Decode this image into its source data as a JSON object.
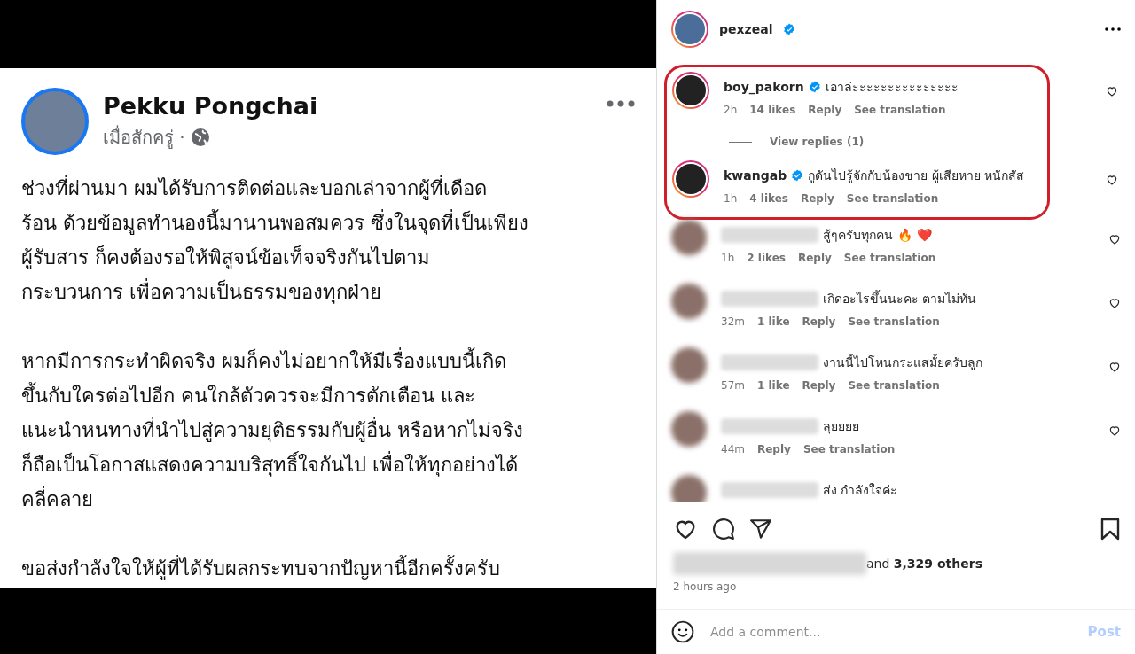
{
  "post_image": {
    "author": "Pekku Pongchai",
    "meta": "เมื่อสักครู่ ·",
    "paragraphs": [
      [
        "ช่วงที่ผ่านมา ผมได้รับการติดต่อและบอกเล่าจากผู้ที่เดือด",
        "ร้อน ด้วยข้อมูลทำนองนี้มานานพอสมควร ซึ่งในจุดที่เป็นเพียง",
        "ผู้รับสาร ก็คงต้องรอให้พิสูจน์ข้อเท็จจริงกันไปตาม",
        "กระบวนการ เพื่อความเป็นธรรมของทุกฝ่าย"
      ],
      [
        "หากมีการกระทำผิดจริง ผมก็คงไม่อยากให้มีเรื่องแบบนี้เกิด",
        "ขึ้นกับใครต่อไปอีก คนใกล้ตัวควรจะมีการตักเตือน และ",
        "แนะนำหนทางที่นำไปสู่ความยุติธรรมกับผู้อื่น หรือหากไม่จริง",
        "ก็ถือเป็นโอกาสแสดงความบริสุทธิ์ใจกันไป เพื่อให้ทุกอย่างได้",
        "คลี่คลาย"
      ],
      [
        "ขอส่งกำลังใจให้ผู้ที่ได้รับผลกระทบจากปัญหานี้อีกครั้งครับ"
      ]
    ]
  },
  "header": {
    "username": "pexzeal",
    "verified": true
  },
  "comments": [
    {
      "username": "boy_pakorn",
      "verified": true,
      "highlighted": true,
      "text": "เอาล่ะะะะะะะะะะะะะะะ",
      "time": "2h",
      "likes": "14 likes",
      "reply": "Reply",
      "translate": "See translation",
      "view_replies": "View replies (1)"
    },
    {
      "username": "kwangab",
      "verified": true,
      "highlighted": true,
      "text": "กูดันไปรู้จักกับน้องชาย ผู้เสียหาย หนักสัส",
      "time": "1h",
      "likes": "4 likes",
      "reply": "Reply",
      "translate": "See translation"
    },
    {
      "verified": false,
      "highlighted": false,
      "text": "สู้ๆครับทุกคน",
      "emojis": [
        "🔥",
        "❤️"
      ],
      "time": "1h",
      "likes": "2 likes",
      "reply": "Reply",
      "translate": "See translation"
    },
    {
      "verified": false,
      "highlighted": false,
      "text": "เกิดอะไรขึ้นนะคะ ตามไม่ทัน",
      "time": "32m",
      "likes": "1 like",
      "reply": "Reply",
      "translate": "See translation"
    },
    {
      "verified": false,
      "highlighted": false,
      "text": "งานนี้ไปโหนกระแสมั้ยครับลูก",
      "time": "57m",
      "likes": "1 like",
      "reply": "Reply",
      "translate": "See translation"
    },
    {
      "verified": false,
      "highlighted": false,
      "text": "ลุยยยย",
      "time": "44m",
      "reply": "Reply",
      "translate": "See translation"
    },
    {
      "verified": false,
      "highlighted": false,
      "text": "ส่ง กำลังใจค่ะ"
    }
  ],
  "likes": {
    "text": "and ",
    "count": "3,329 others"
  },
  "posted": "2 hours ago",
  "add_comment": {
    "placeholder": "Add a comment...",
    "post": "Post"
  }
}
